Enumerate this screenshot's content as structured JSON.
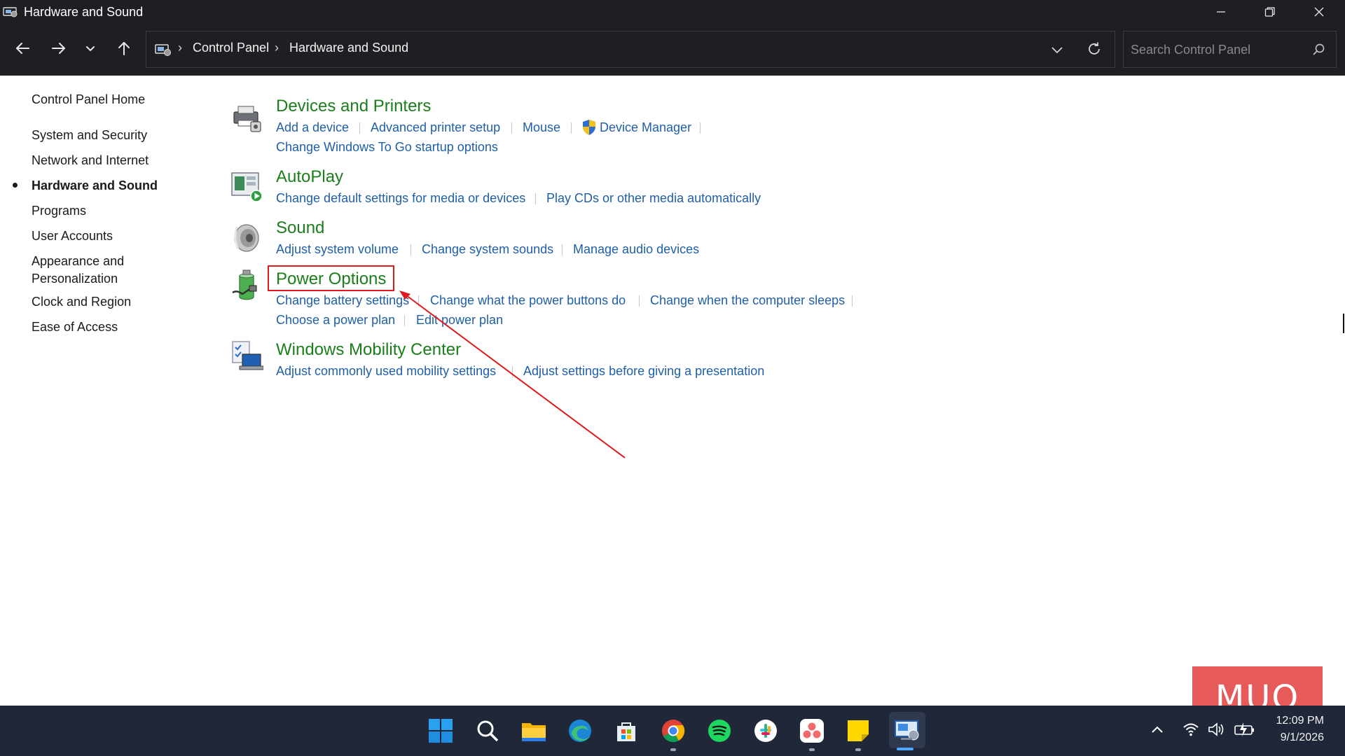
{
  "window": {
    "title": "Hardware and Sound"
  },
  "address": {
    "crumbs": [
      "Control Panel",
      "Hardware and Sound"
    ],
    "search_placeholder": "Search Control Panel"
  },
  "sidebar": {
    "home": "Control Panel Home",
    "items": [
      {
        "label": "System and Security"
      },
      {
        "label": "Network and Internet"
      },
      {
        "label": "Hardware and Sound",
        "active": true
      },
      {
        "label": "Programs"
      },
      {
        "label": "User Accounts"
      },
      {
        "label": "Appearance and\nPersonalization"
      },
      {
        "label": "Clock and Region"
      },
      {
        "label": "Ease of Access"
      }
    ]
  },
  "categories": [
    {
      "title": "Devices and Printers",
      "links": [
        "Add a device",
        "Advanced printer setup",
        "Mouse",
        "Device Manager",
        "Change Windows To Go startup options"
      ]
    },
    {
      "title": "AutoPlay",
      "links": [
        "Change default settings for media or devices",
        "Play CDs or other media automatically"
      ]
    },
    {
      "title": "Sound",
      "links": [
        "Adjust system volume",
        "Change system sounds",
        "Manage audio devices"
      ]
    },
    {
      "title": "Power Options",
      "links": [
        "Change battery settings",
        "Change what the power buttons do",
        "Change when the computer sleeps",
        "Choose a power plan",
        "Edit power plan"
      ]
    },
    {
      "title": "Windows Mobility Center",
      "links": [
        "Adjust commonly used mobility settings",
        "Adjust settings before giving a presentation"
      ]
    }
  ],
  "taskbar": {
    "apps": [
      "start-icon",
      "search-icon",
      "file-explorer-icon",
      "edge-icon",
      "microsoft-store-icon",
      "chrome-icon",
      "spotify-icon",
      "slack-icon",
      "asana-icon",
      "sticky-notes-icon",
      "control-panel-icon"
    ],
    "time": "12:09 PM",
    "date": "9/1/2026"
  },
  "watermark": "MUO",
  "colors": {
    "title_green": "#1a7f1a",
    "link_blue": "#1f5fa6",
    "highlight_red": "#e0191d",
    "chrome_dark": "#1d1f23",
    "taskbar": "#1f2738"
  }
}
